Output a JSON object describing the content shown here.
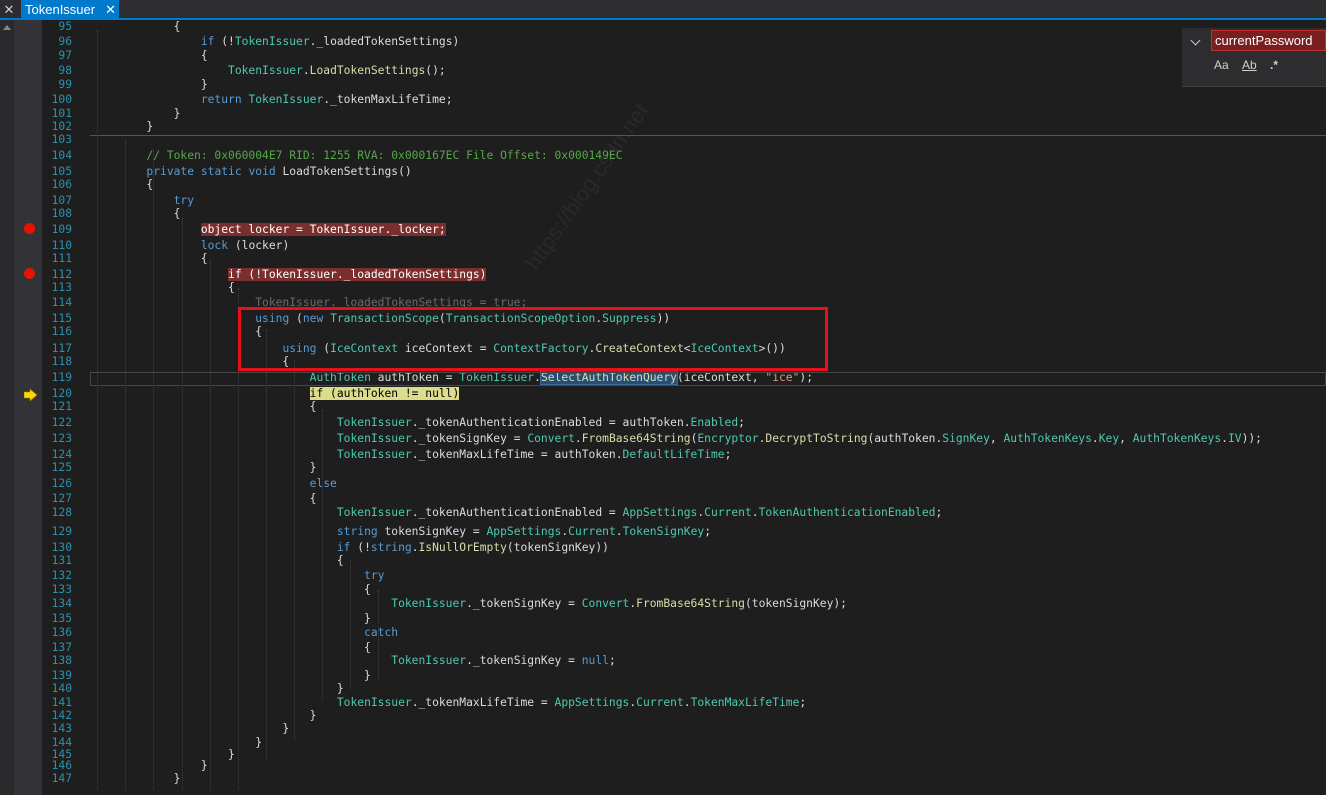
{
  "tab": {
    "title": "TokenIssuer",
    "close_glyph": "✕"
  },
  "find": {
    "query": "currentPassword",
    "match_case": "Aa",
    "whole_word": "Ab",
    "regex": ".*"
  },
  "colors": {
    "accent": "#007acc",
    "breakpoint": "#e51400",
    "highlight_box": "#e8101e"
  },
  "lines": [
    {
      "n": "95",
      "code": "            {"
    },
    {
      "n": "96",
      "code": "                if (!TokenIssuer._loadedTokenSettings)"
    },
    {
      "n": "97",
      "code": "                {"
    },
    {
      "n": "98",
      "code": "                    TokenIssuer.LoadTokenSettings();"
    },
    {
      "n": "99",
      "code": "                }"
    },
    {
      "n": "100",
      "code": "                return TokenIssuer._tokenMaxLifeTime;"
    },
    {
      "n": "101",
      "code": "            }"
    },
    {
      "n": "102",
      "code": "        }"
    },
    {
      "n": "103",
      "code": ""
    },
    {
      "n": "104",
      "code": "        // Token: 0x060004E7 RID: 1255 RVA: 0x000167EC File Offset: 0x000149EC"
    },
    {
      "n": "105",
      "code": "        private static void LoadTokenSettings()"
    },
    {
      "n": "106",
      "code": "        {"
    },
    {
      "n": "107",
      "code": "            try"
    },
    {
      "n": "108",
      "code": "            {"
    },
    {
      "n": "109",
      "code": "                object locker = TokenIssuer._locker;"
    },
    {
      "n": "110",
      "code": "                lock (locker)"
    },
    {
      "n": "111",
      "code": "                {"
    },
    {
      "n": "112",
      "code": "                    if (!TokenIssuer._loadedTokenSettings)"
    },
    {
      "n": "113",
      "code": "                    {"
    },
    {
      "n": "114",
      "code": "                        TokenIssuer._loadedTokenSettings = true;"
    },
    {
      "n": "115",
      "code": "                        using (new TransactionScope(TransactionScopeOption.Suppress))"
    },
    {
      "n": "116",
      "code": "                        {"
    },
    {
      "n": "117",
      "code": "                            using (IceContext iceContext = ContextFactory.CreateContext<IceContext>())"
    },
    {
      "n": "118",
      "code": "                            {"
    },
    {
      "n": "119",
      "code": "                                AuthToken authToken = TokenIssuer.SelectAuthTokenQuery(iceContext, \"ice\");"
    },
    {
      "n": "120",
      "code": "                                if (authToken != null)"
    },
    {
      "n": "121",
      "code": "                                {"
    },
    {
      "n": "122",
      "code": "                                    TokenIssuer._tokenAuthenticationEnabled = authToken.Enabled;"
    },
    {
      "n": "123",
      "code": "                                    TokenIssuer._tokenSignKey = Convert.FromBase64String(Encryptor.DecryptToString(authToken.SignKey, AuthTokenKeys.Key, AuthTokenKeys.IV));"
    },
    {
      "n": "124",
      "code": "                                    TokenIssuer._tokenMaxLifeTime = authToken.DefaultLifeTime;"
    },
    {
      "n": "125",
      "code": "                                }"
    },
    {
      "n": "126",
      "code": "                                else"
    },
    {
      "n": "127",
      "code": "                                {"
    },
    {
      "n": "128",
      "code": "                                    TokenIssuer._tokenAuthenticationEnabled = AppSettings.Current.TokenAuthenticationEnabled;"
    },
    {
      "n": "129",
      "code": "                                    string tokenSignKey = AppSettings.Current.TokenSignKey;"
    },
    {
      "n": "130",
      "code": "                                    if (!string.IsNullOrEmpty(tokenSignKey))"
    },
    {
      "n": "131",
      "code": "                                    {"
    },
    {
      "n": "132",
      "code": "                                        try"
    },
    {
      "n": "133",
      "code": "                                        {"
    },
    {
      "n": "134",
      "code": "                                            TokenIssuer._tokenSignKey = Convert.FromBase64String(tokenSignKey);"
    },
    {
      "n": "135",
      "code": "                                        }"
    },
    {
      "n": "136",
      "code": "                                        catch"
    },
    {
      "n": "137",
      "code": "                                        {"
    },
    {
      "n": "138",
      "code": "                                            TokenIssuer._tokenSignKey = null;"
    },
    {
      "n": "139",
      "code": "                                        }"
    },
    {
      "n": "140",
      "code": "                                    }"
    },
    {
      "n": "141",
      "code": "                                    TokenIssuer._tokenMaxLifeTime = AppSettings.Current.TokenMaxLifeTime;"
    },
    {
      "n": "142",
      "code": "                                }"
    },
    {
      "n": "143",
      "code": "                            }"
    },
    {
      "n": "144",
      "code": "                        }"
    },
    {
      "n": "145",
      "code": "                    }"
    },
    {
      "n": "146",
      "code": "                }"
    },
    {
      "n": "147",
      "code": "            }"
    }
  ]
}
